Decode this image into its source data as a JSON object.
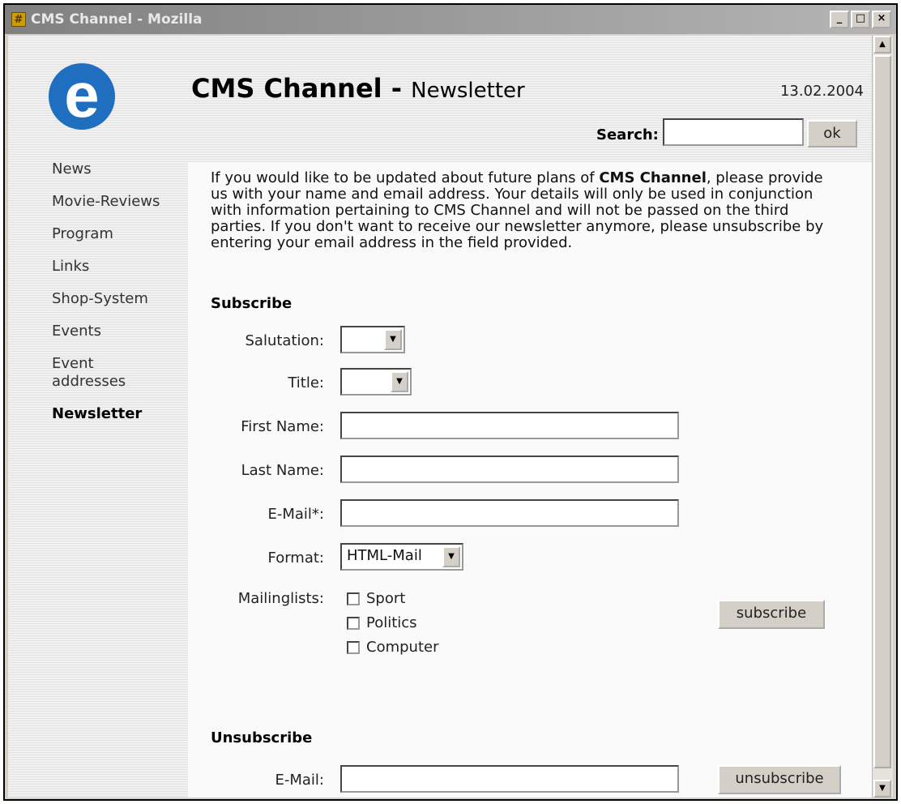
{
  "window": {
    "title": "CMS Channel - Mozilla",
    "min_label": "_",
    "max_label": "□",
    "close_label": "×"
  },
  "header": {
    "logo_letter": "e",
    "site_name": "CMS Channel -",
    "section": "Newsletter",
    "date": "13.02.2004",
    "search_label": "Search:",
    "search_value": "",
    "search_button": "ok"
  },
  "sidebar": {
    "items": [
      {
        "label": "News",
        "active": false
      },
      {
        "label": "Movie-Reviews",
        "active": false
      },
      {
        "label": "Program",
        "active": false
      },
      {
        "label": "Links",
        "active": false
      },
      {
        "label": "Shop-System",
        "active": false
      },
      {
        "label": "Events",
        "active": false
      },
      {
        "label": "Event addresses",
        "active": false
      },
      {
        "label": "Newsletter",
        "active": true
      }
    ]
  },
  "main": {
    "intro_before": "If you would like to be updated about future plans of ",
    "intro_bold": "CMS Channel",
    "intro_after": ", please provide us with your name and email address. Your details will only be used in conjunction with information pertaining to CMS Channel and will not be passed on the third parties. If you don't want to receive our newsletter anymore, please unsubscribe by entering your email address in the field provided.",
    "subscribe": {
      "heading": "Subscribe",
      "salutation_label": "Salutation:",
      "salutation_value": "",
      "title_label": "Title:",
      "title_value": "",
      "first_name_label": "First Name:",
      "first_name_value": "",
      "last_name_label": "Last Name:",
      "last_name_value": "",
      "email_label": "E-Mail*:",
      "email_value": "",
      "format_label": "Format:",
      "format_value": "HTML-Mail",
      "mailinglists_label": "Mailinglists:",
      "lists": [
        {
          "label": "Sport",
          "checked": false
        },
        {
          "label": "Politics",
          "checked": false
        },
        {
          "label": "Computer",
          "checked": false
        }
      ],
      "button": "subscribe"
    },
    "unsubscribe": {
      "heading": "Unsubscribe",
      "email_label": "E-Mail:",
      "email_value": "",
      "button": "unsubscribe"
    }
  },
  "colors": {
    "logo": "#1f6ec0",
    "chrome": "#d4d0c8"
  }
}
